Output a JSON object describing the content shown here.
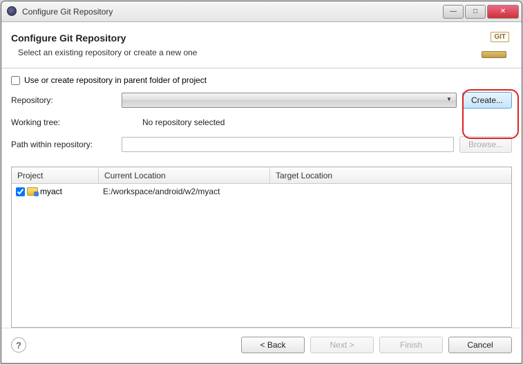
{
  "window": {
    "title": "Configure Git Repository"
  },
  "header": {
    "title": "Configure Git Repository",
    "subtitle": "Select an existing repository or create a new one"
  },
  "form": {
    "use_parent_label": "Use or create repository in parent folder of project",
    "use_parent_checked": false,
    "repository_label": "Repository:",
    "create_label": "Create...",
    "working_tree_label": "Working tree:",
    "working_tree_value": "No repository selected",
    "path_label": "Path within repository:",
    "path_value": "",
    "browse_label": "Browse..."
  },
  "table": {
    "columns": {
      "project": "Project",
      "current": "Current Location",
      "target": "Target Location"
    },
    "rows": [
      {
        "checked": true,
        "name": "myact",
        "current": "E:/workspace/android/w2/myact",
        "target": ""
      }
    ]
  },
  "buttons": {
    "back": "< Back",
    "next": "Next >",
    "finish": "Finish",
    "cancel": "Cancel"
  }
}
